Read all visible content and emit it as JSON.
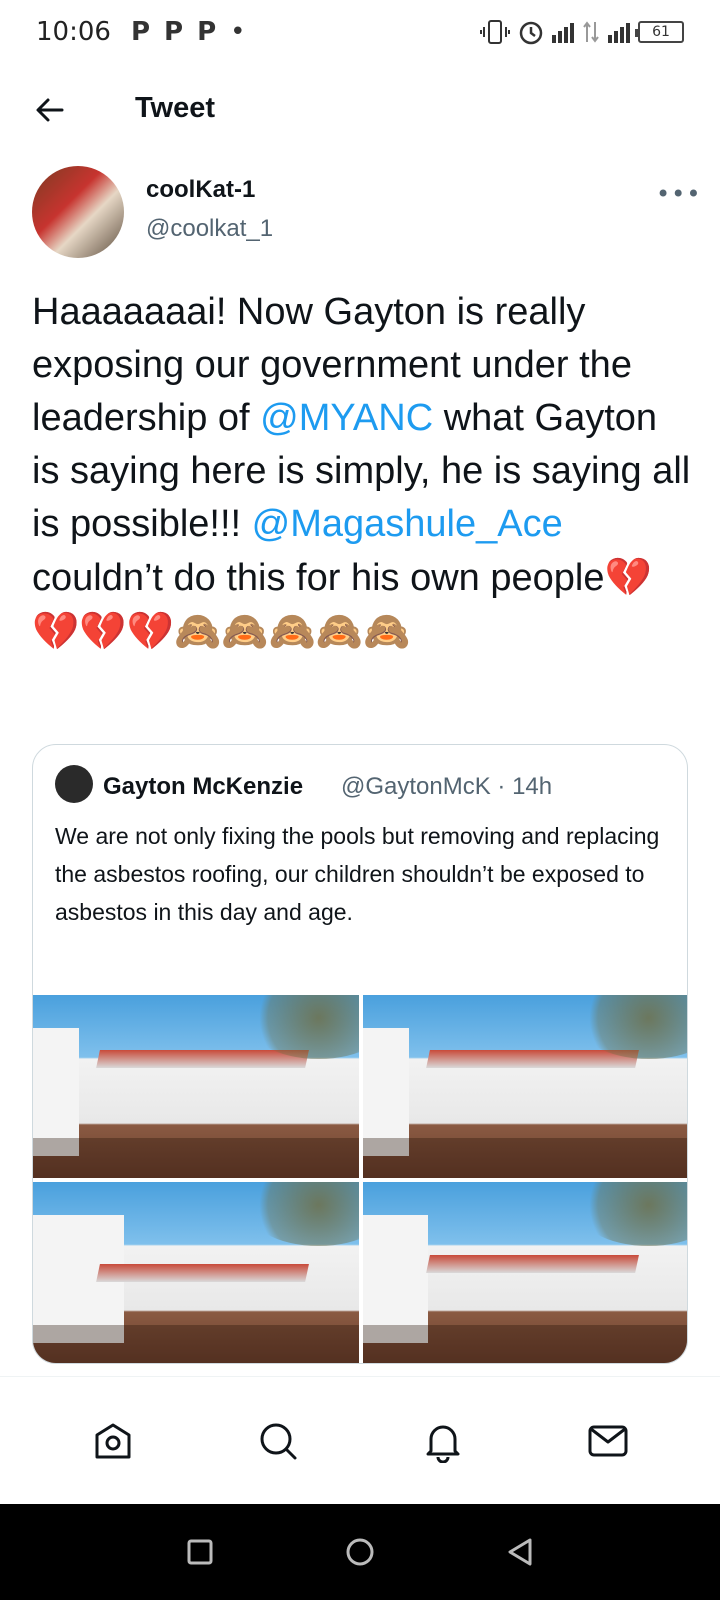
{
  "status_bar": {
    "time": "10:06",
    "left_icons": [
      "P",
      "P",
      "P",
      "•"
    ],
    "battery": "61"
  },
  "header": {
    "title": "Tweet"
  },
  "tweet": {
    "author_name": "coolKat-1",
    "author_handle": "@coolkat_1",
    "text_parts": {
      "p1": "Haaaaaaai! Now Gayton is really exposing our government under the leadership of ",
      "mention1": "@MYANC",
      "p2": " what Gayton is saying here is simply, he is saying all is possible!!! ",
      "mention2": "@Magashule_Ace",
      "p3": " couldn’t do this for his own people",
      "emojis": "💔💔💔💔🙈🙈🙈🙈🙈"
    }
  },
  "quoted_tweet": {
    "author_name": "Gayton McKenzie",
    "author_handle": "@GaytonMcK · 14h",
    "text": "We are not only fixing the pools but removing and replacing the asbestos roofing, our children shouldn’t be exposed to asbestos in this day and age.",
    "photos": [
      "roof-photo-1",
      "roof-photo-2",
      "roof-photo-3",
      "roof-photo-4"
    ]
  },
  "bottom_nav": {
    "items": [
      "home-icon",
      "search-icon",
      "notifications-icon",
      "messages-icon"
    ]
  },
  "colors": {
    "accent": "#1d9bf0",
    "secondary_text": "#536471",
    "text": "#0f1419"
  }
}
